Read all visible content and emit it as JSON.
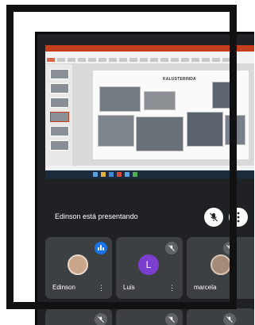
{
  "slide": {
    "title": "KALUSTERINDA"
  },
  "presenter": {
    "text": "Edinson está presentando",
    "mic_icon": "mic-off-icon",
    "more_icon": "more-icon"
  },
  "participants": [
    {
      "name": "Edinson",
      "avatar": "photo",
      "status": "speaking"
    },
    {
      "name": "Luis",
      "avatar_letter": "L",
      "status": "muted"
    },
    {
      "name": "marcela",
      "avatar": "photo",
      "status": "muted"
    }
  ],
  "colors": {
    "meet_bg": "#202124",
    "tile_bg": "#3c4043",
    "accent": "#1a73e8",
    "avatar_luis": "#7b3fd0"
  }
}
